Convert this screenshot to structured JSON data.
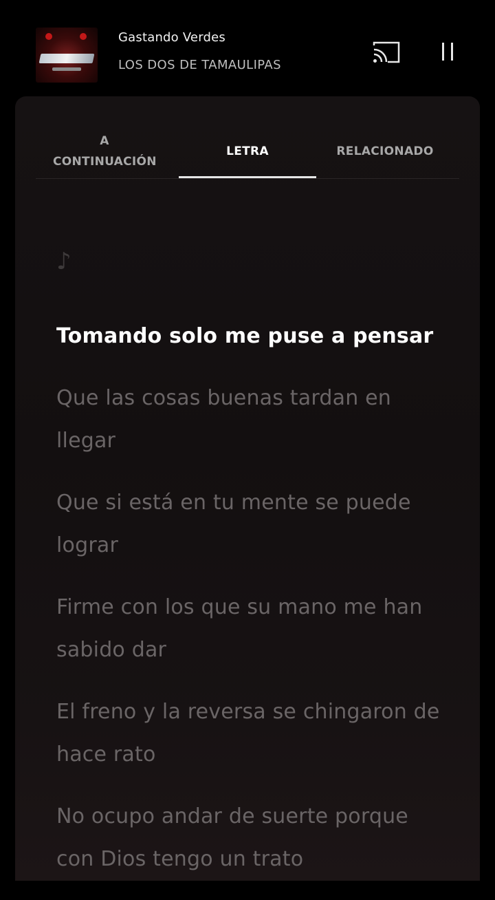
{
  "player": {
    "song_title": "Gastando Verdes",
    "artist": "LOS DOS DE TAMAULIPAS",
    "cast_icon": "cast-icon",
    "pause_icon": "pause-icon"
  },
  "tabs": [
    {
      "label": "A CONTINUACIÓN",
      "active": false
    },
    {
      "label": "LETRA",
      "active": true
    },
    {
      "label": "RELACIONADO",
      "active": false
    }
  ],
  "lyrics": {
    "note_symbol": "♪",
    "lines": [
      "Tomando solo me puse a pensar",
      "Que las cosas buenas tardan en llegar",
      "Que si está en tu mente se puede lograr",
      "Firme con los que su mano me han sabido dar",
      "El freno y la reversa se chingaron de hace rato",
      "No ocupo andar de suerte porque con Dios tengo un trato"
    ],
    "current_index": 0
  },
  "colors": {
    "background": "#000000",
    "panel": "#151112",
    "active_text": "#ffffff",
    "inactive_text": "#6a6566"
  }
}
